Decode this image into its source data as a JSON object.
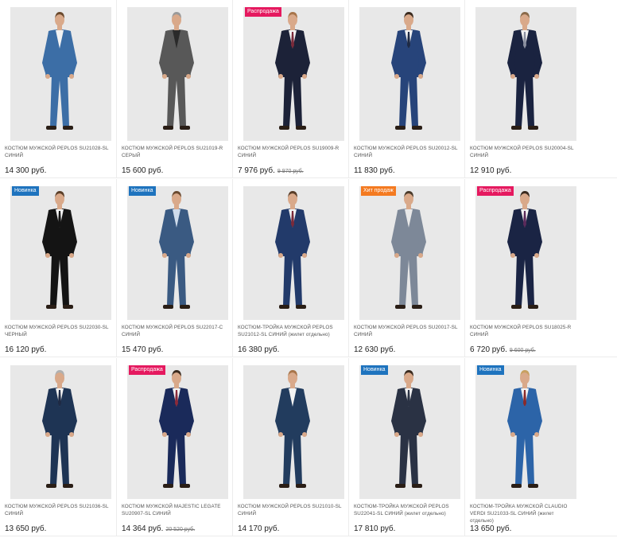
{
  "colors": {
    "sale": "#e5195f",
    "new": "#1e73be",
    "hit": "#f47a20",
    "background": "#e8e8e8"
  },
  "products": [
    {
      "title": "КОСТЮМ МУЖСКОЙ PEPLOS SU21028-SL СИНИЙ",
      "note": "",
      "price": "14 300 руб.",
      "old_price": "",
      "badge": "",
      "badge_type": "",
      "suit": "#3c6ea6",
      "shirt": "#f2f2f2",
      "tie": "",
      "hair": "#6b4a2e"
    },
    {
      "title": "КОСТЮМ МУЖСКОЙ PEPLOS SU21019-R СЕРЫЙ",
      "note": "",
      "price": "15 600 руб.",
      "old_price": "",
      "badge": "",
      "badge_type": "",
      "suit": "#585858",
      "shirt": "#2a2a2a",
      "tie": "",
      "hair": "#9a9a9a"
    },
    {
      "title": "КОСТЮМ МУЖСКОЙ PEPLOS SU19009-R СИНИЙ",
      "note": "",
      "price": "7 976 руб.",
      "old_price": "9 970 руб.",
      "badge": "Распродажа",
      "badge_type": "sale",
      "suit": "#1c2238",
      "shirt": "#f2f2f2",
      "tie": "#7a2a3a",
      "hair": "#a8754a"
    },
    {
      "title": "КОСТЮМ МУЖСКОЙ PEPLOS SU20012-SL СИНИЙ",
      "note": "",
      "price": "11 830 руб.",
      "old_price": "",
      "badge": "",
      "badge_type": "",
      "suit": "#27447a",
      "shirt": "#f2f2f2",
      "tie": "#1e2a44",
      "hair": "#3a2a1e"
    },
    {
      "title": "КОСТЮМ МУЖСКОЙ PEPLOS SU20004-SL СИНИЙ",
      "note": "",
      "price": "12 910 руб.",
      "old_price": "",
      "badge": "",
      "badge_type": "",
      "suit": "#1a2340",
      "shirt": "#f2f2f2",
      "tie": "#8a8fa0",
      "hair": "#8a6a4a"
    },
    {
      "title": "КОСТЮМ МУЖСКОЙ PEPLOS SU22030-SL ЧЕРНЫЙ",
      "note": "",
      "price": "16 120 руб.",
      "old_price": "",
      "badge": "Новинка",
      "badge_type": "new",
      "suit": "#141414",
      "shirt": "#f2f2f2",
      "tie": "#141414",
      "hair": "#5a3e28"
    },
    {
      "title": "КОСТЮМ МУЖСКОЙ PEPLOS SU22017-C СИНИЙ",
      "note": "",
      "price": "15 470 руб.",
      "old_price": "",
      "badge": "Новинка",
      "badge_type": "new",
      "suit": "#3a5a82",
      "shirt": "#cfdcec",
      "tie": "",
      "hair": "#6a4a30"
    },
    {
      "title": "КОСТЮМ-ТРОЙКА МУЖСКОЙ PEPLOS SU21012-SL СИНИЙ",
      "note": "(жилет отдельно)",
      "price": "16 380 руб.",
      "old_price": "",
      "badge": "",
      "badge_type": "",
      "suit": "#223a6a",
      "shirt": "#f2f2f2",
      "tie": "#7a2a3a",
      "hair": "#5a3e28"
    },
    {
      "title": "КОСТЮМ МУЖСКОЙ PEPLOS SU20017-SL СИНИЙ",
      "note": "",
      "price": "12 630 руб.",
      "old_price": "",
      "badge": "Хит продаж",
      "badge_type": "hit",
      "suit": "#7d8898",
      "shirt": "#e8e8e8",
      "tie": "",
      "hair": "#4a3a2a"
    },
    {
      "title": "КОСТЮМ МУЖСКОЙ PEPLOS SU18025-R СИНИЙ",
      "note": "",
      "price": "6 720 руб.",
      "old_price": "9 600 руб.",
      "badge": "Распродажа",
      "badge_type": "sale",
      "suit": "#1a2444",
      "shirt": "#f2f2f2",
      "tie": "#5a2a5a",
      "hair": "#3a2a1e"
    },
    {
      "title": "КОСТЮМ МУЖСКОЙ PEPLOS SU21036-SL СИНИЙ",
      "note": "",
      "price": "13 650 руб.",
      "old_price": "",
      "badge": "",
      "badge_type": "",
      "suit": "#1e3454",
      "shirt": "#f2f2f2",
      "tie": "#1e2a44",
      "hair": "#b0b0b0"
    },
    {
      "title": "КОСТЮМ МУЖСКОЙ MAJESTIC LEGATE SU20907-SL СИНИЙ",
      "note": "",
      "price": "14 364 руб.",
      "old_price": "20 520 руб.",
      "badge": "Распродажа",
      "badge_type": "sale",
      "suit": "#1a2a5a",
      "shirt": "#f2f2f2",
      "tie": "#8a2a3a",
      "hair": "#3a2a1e"
    },
    {
      "title": "КОСТЮМ МУЖСКОЙ PEPLOS SU21010-SL СИНИЙ",
      "note": "",
      "price": "14 170 руб.",
      "old_price": "",
      "badge": "",
      "badge_type": "",
      "suit": "#223c5e",
      "shirt": "#f2f2f2",
      "tie": "",
      "hair": "#a8754a"
    },
    {
      "title": "КОСТЮМ-ТРОЙКА МУЖСКОЙ PEPLOS SU22041-SL СИНИЙ",
      "note": "(жилет отдельно)",
      "price": "17 810 руб.",
      "old_price": "",
      "badge": "Новинка",
      "badge_type": "new",
      "suit": "#2a3244",
      "shirt": "#f2f2f2",
      "tie": "#2a3244",
      "hair": "#3a2a1e"
    },
    {
      "title": "КОСТЮМ-ТРОЙКА МУЖСКОЙ CLAUDIO VERDI SU21033-SL СИНИЙ",
      "note": "(жилет отдельно)",
      "price": "13 650 руб.",
      "old_price": "",
      "badge": "Новинка",
      "badge_type": "new",
      "suit": "#2c64a8",
      "shirt": "#f2f2f2",
      "tie": "#8a2a2a",
      "hair": "#c8a060"
    }
  ]
}
